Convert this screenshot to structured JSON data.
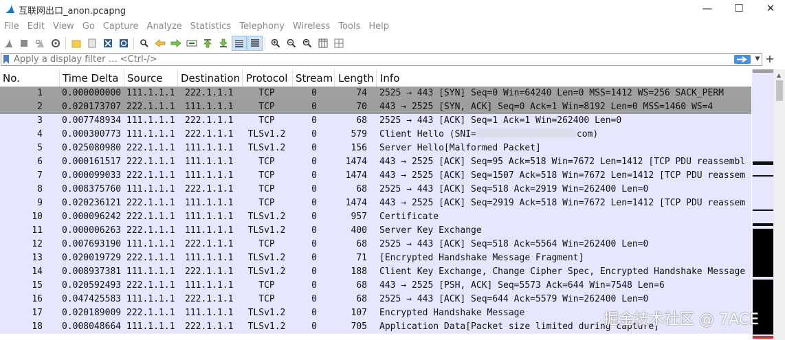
{
  "window": {
    "title": "互联网出口_anon.pcapng",
    "minimize": "—",
    "maximize": "☐",
    "close": "✕"
  },
  "menu": [
    "File",
    "Edit",
    "View",
    "Go",
    "Capture",
    "Analyze",
    "Statistics",
    "Telephony",
    "Wireless",
    "Tools",
    "Help"
  ],
  "filter": {
    "placeholder": "Apply a display filter … <Ctrl-/>"
  },
  "columns": [
    "No.",
    "Time Delta",
    "Source",
    "Destination",
    "Protocol",
    "Stream",
    "Length",
    "Info"
  ],
  "packets": [
    {
      "no": "1",
      "time": "0.000000000",
      "src": "111.1.1.1",
      "dst": "222.1.1.1",
      "proto": "TCP",
      "stream": "0",
      "len": "74",
      "info": "2525 → 443 [SYN] Seq=0 Win=64240 Len=0 MSS=1412 WS=256 SACK_PERM"
    },
    {
      "no": "2",
      "time": "0.020173707",
      "src": "222.1.1.1",
      "dst": "111.1.1.1",
      "proto": "TCP",
      "stream": "0",
      "len": "70",
      "info": "443 → 2525 [SYN, ACK] Seq=0 Ack=1 Win=8192 Len=0 MSS=1460 WS=4"
    },
    {
      "no": "3",
      "time": "0.007748934",
      "src": "111.1.1.1",
      "dst": "222.1.1.1",
      "proto": "TCP",
      "stream": "0",
      "len": "68",
      "info": "2525 → 443 [ACK] Seq=1 Ack=1 Win=262400 Len=0"
    },
    {
      "no": "4",
      "time": "0.000300773",
      "src": "111.1.1.1",
      "dst": "222.1.1.1",
      "proto": "TLSv1.2",
      "stream": "0",
      "len": "579",
      "info": "Client Hello (SNI=",
      "info_tail": "com)"
    },
    {
      "no": "5",
      "time": "0.025080980",
      "src": "222.1.1.1",
      "dst": "111.1.1.1",
      "proto": "TLSv1.2",
      "stream": "0",
      "len": "156",
      "info": "Server Hello[Malformed Packet]"
    },
    {
      "no": "6",
      "time": "0.000161517",
      "src": "222.1.1.1",
      "dst": "111.1.1.1",
      "proto": "TCP",
      "stream": "0",
      "len": "1474",
      "info": "443 → 2525 [ACK] Seq=95 Ack=518 Win=7672 Len=1412 [TCP PDU reassembl"
    },
    {
      "no": "7",
      "time": "0.000099033",
      "src": "222.1.1.1",
      "dst": "111.1.1.1",
      "proto": "TCP",
      "stream": "0",
      "len": "1474",
      "info": "443 → 2525 [ACK] Seq=1507 Ack=518 Win=7672 Len=1412 [TCP PDU reassem"
    },
    {
      "no": "8",
      "time": "0.008375760",
      "src": "111.1.1.1",
      "dst": "222.1.1.1",
      "proto": "TCP",
      "stream": "0",
      "len": "68",
      "info": "2525 → 443 [ACK] Seq=518 Ack=2919 Win=262400 Len=0"
    },
    {
      "no": "9",
      "time": "0.020236121",
      "src": "222.1.1.1",
      "dst": "111.1.1.1",
      "proto": "TCP",
      "stream": "0",
      "len": "1474",
      "info": "443 → 2525 [ACK] Seq=2919 Ack=518 Win=7672 Len=1412 [TCP PDU reassem"
    },
    {
      "no": "10",
      "time": "0.000096242",
      "src": "222.1.1.1",
      "dst": "111.1.1.1",
      "proto": "TLSv1.2",
      "stream": "0",
      "len": "957",
      "info": "Certificate"
    },
    {
      "no": "11",
      "time": "0.000006263",
      "src": "222.1.1.1",
      "dst": "111.1.1.1",
      "proto": "TLSv1.2",
      "stream": "0",
      "len": "400",
      "info": "Server Key Exchange"
    },
    {
      "no": "12",
      "time": "0.007693190",
      "src": "111.1.1.1",
      "dst": "222.1.1.1",
      "proto": "TCP",
      "stream": "0",
      "len": "68",
      "info": "2525 → 443 [ACK] Seq=518 Ack=5564 Win=262400 Len=0"
    },
    {
      "no": "13",
      "time": "0.020019729",
      "src": "222.1.1.1",
      "dst": "111.1.1.1",
      "proto": "TLSv1.2",
      "stream": "0",
      "len": "71",
      "info": "[Encrypted Handshake Message Fragment]"
    },
    {
      "no": "14",
      "time": "0.008937381",
      "src": "111.1.1.1",
      "dst": "222.1.1.1",
      "proto": "TLSv1.2",
      "stream": "0",
      "len": "188",
      "info": "Client Key Exchange, Change Cipher Spec, Encrypted Handshake Message"
    },
    {
      "no": "15",
      "time": "0.020592493",
      "src": "222.1.1.1",
      "dst": "111.1.1.1",
      "proto": "TCP",
      "stream": "0",
      "len": "68",
      "info": "443 → 2525 [PSH, ACK] Seq=5573 Ack=644 Win=7548 Len=6"
    },
    {
      "no": "16",
      "time": "0.047425583",
      "src": "111.1.1.1",
      "dst": "222.1.1.1",
      "proto": "TCP",
      "stream": "0",
      "len": "68",
      "info": "2525 → 443 [ACK] Seq=644 Ack=5579 Win=262400 Len=0"
    },
    {
      "no": "17",
      "time": "0.020189009",
      "src": "222.1.1.1",
      "dst": "111.1.1.1",
      "proto": "TLSv1.2",
      "stream": "0",
      "len": "107",
      "info": "Encrypted Handshake Message"
    },
    {
      "no": "18",
      "time": "0.008048664",
      "src": "111.1.1.1",
      "dst": "222.1.1.1",
      "proto": "TLSv1.2",
      "stream": "0",
      "len": "705",
      "info": "Application Data[Packet size limited during capture]"
    }
  ],
  "watermark": "掘金技术社区 @ 7ACE",
  "colors": {
    "row_default": "#e7e6ff",
    "row_selected": "#a0a0a0",
    "accent": "#4a8fd8"
  }
}
